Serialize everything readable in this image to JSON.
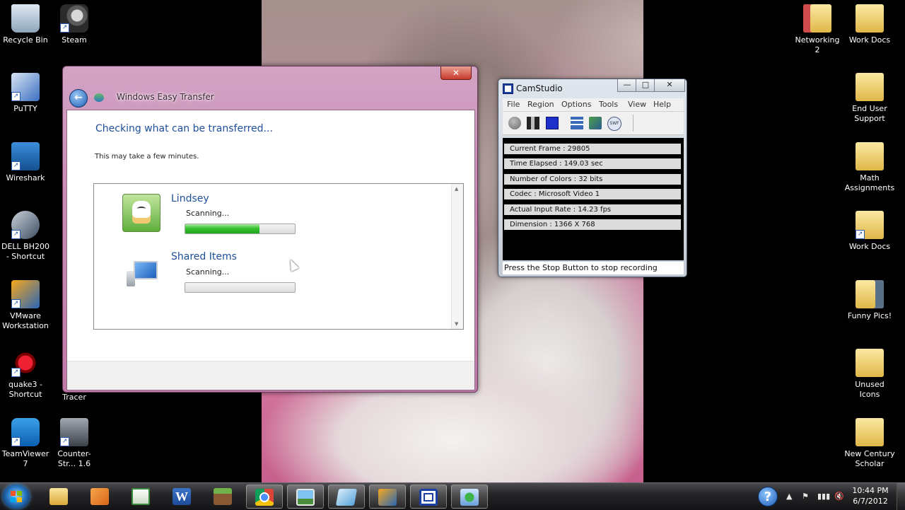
{
  "desktop": {
    "left_icons": [
      {
        "label": "Recycle Bin"
      },
      {
        "label": "Steam"
      },
      {
        "label": "PuTTY"
      },
      {
        "label": "Wireshark"
      },
      {
        "label": "DELL BH200 - Shortcut"
      },
      {
        "label": "VMware Workstation"
      },
      {
        "label": "quake3 - Shortcut"
      },
      {
        "label": "Tracer"
      },
      {
        "label": "TeamViewer 7"
      },
      {
        "label": "Counter-Str... 1.6"
      }
    ],
    "right_icons": [
      {
        "label": "Networking 2"
      },
      {
        "label": "Work Docs"
      },
      {
        "label": "End User Support"
      },
      {
        "label": "Math Assignments"
      },
      {
        "label": "Work Docs"
      },
      {
        "label": "Funny Pics!"
      },
      {
        "label": "Unused Icons"
      },
      {
        "label": "New Century Scholar"
      }
    ]
  },
  "easy_transfer": {
    "window_title": "Windows Easy Transfer",
    "close_glyph": "✕",
    "heading": "Checking what can be transferred...",
    "subtext": "This may take a few minutes.",
    "items": [
      {
        "name": "Lindsey",
        "status": "Scanning...",
        "progress": 0.68,
        "icon": "user-avatar-icon"
      },
      {
        "name": "Shared Items",
        "status": "Scanning...",
        "progress": 0.0,
        "icon": "computer-icon"
      }
    ]
  },
  "camstudio": {
    "title": "CamStudio",
    "menu": [
      "File",
      "Region",
      "Options",
      "Tools",
      "View",
      "Help"
    ],
    "stats": [
      "Current Frame : 29805",
      "Time Elapsed  : 149.03 sec",
      "Number of Colors  : 32 bits",
      "Codec  : Microsoft Video 1",
      "Actual Input Rate  : 14.23 fps",
      "Dimension  : 1366 X 768"
    ],
    "status": "Press the Stop Button to stop recording",
    "minimize_glyph": "—",
    "maximize_glyph": "□",
    "close_glyph": "✕"
  },
  "taskbar": {
    "apps": [
      "Windows Explorer",
      "Windows Media Player",
      "Notepad++",
      "Microsoft Word",
      "Minecraft",
      "Google Chrome",
      "Windows Photo Viewer",
      "Windows Live Mail",
      "VMware",
      "CamStudio",
      "Windows Easy Transfer"
    ],
    "help_glyph": "?",
    "tray_icons": [
      "▲",
      "⚑",
      "▮▮▮",
      "🔇"
    ],
    "time": "10:44 PM",
    "date": "6/7/2012"
  }
}
